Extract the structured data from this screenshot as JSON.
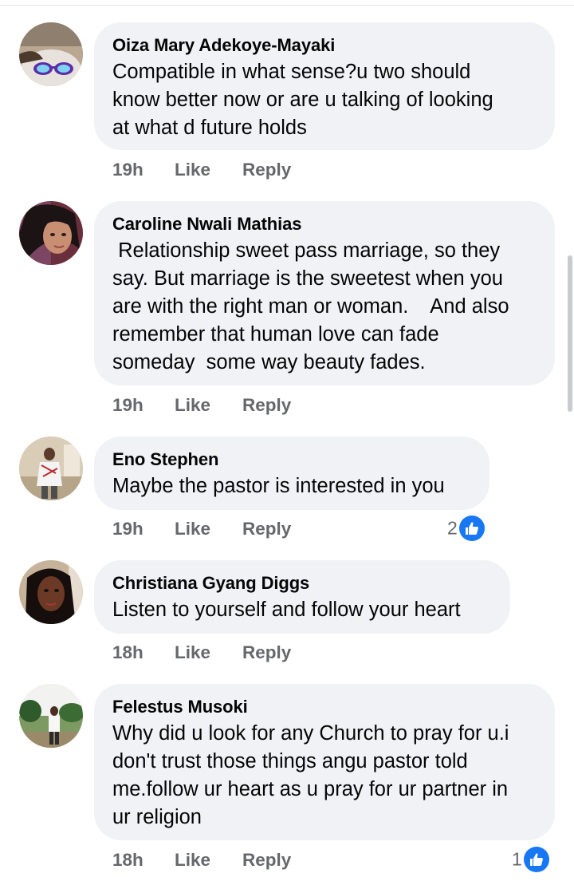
{
  "colors": {
    "bubble": "#f0f2f5",
    "meta_text": "#65676b",
    "like_badge": "#1877f2"
  },
  "action_labels": {
    "like": "Like",
    "reply": "Reply"
  },
  "comments": [
    {
      "author": "Oiza Mary Adekoye-Mayaki",
      "text": "Compatible in what sense?u two should\nknow better now or are u talking of looking\nat what d future holds",
      "time": "19h",
      "avatar_icon": "profile-photo-sunglasses"
    },
    {
      "author": "Caroline Nwali Mathias",
      "text": " Relationship sweet pass marriage, so they\nsay. But marriage is the sweetest when you\nare with the right man or woman.    And also\nremember that human love can fade\nsomeday  some way beauty fades.",
      "time": "19h",
      "avatar_icon": "profile-photo-woman"
    },
    {
      "author": "Eno Stephen",
      "text": "Maybe the pastor is interested in you",
      "time": "19h",
      "reaction_count": "2",
      "reaction_icon": "thumbs-up-icon",
      "avatar_icon": "profile-photo-man-standing"
    },
    {
      "author": "Christiana Gyang Diggs",
      "text": "Listen to yourself and follow your heart",
      "time": "18h",
      "avatar_icon": "profile-photo-woman-portrait"
    },
    {
      "author": "Felestus Musoki",
      "text": "Why did u look for any Church to pray for u.i\ndon't trust those things angu pastor told\nme.follow ur heart as u pray for ur partner in\nur religion",
      "time": "18h",
      "reaction_count": "1",
      "reaction_icon": "thumbs-up-icon",
      "avatar_icon": "profile-photo-man-outdoors"
    }
  ]
}
